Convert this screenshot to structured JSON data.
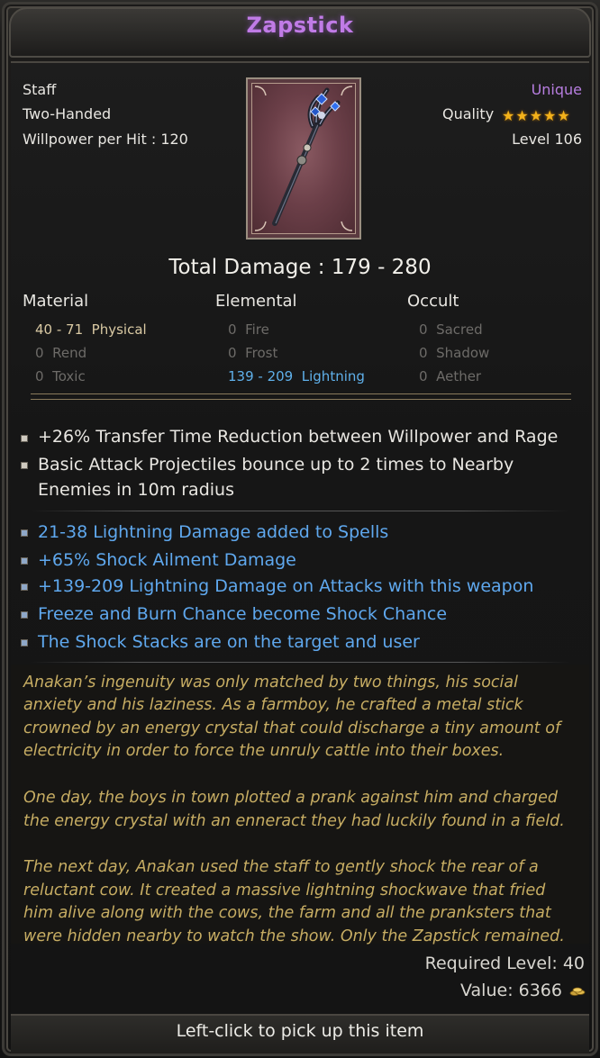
{
  "item": {
    "name": "Zapstick",
    "type": "Staff",
    "handedness": "Two-Handed",
    "willpower_label": "Willpower per Hit : 120",
    "rarity": "Unique",
    "quality_label": "Quality",
    "quality_stars": 5,
    "level_label": "Level 106",
    "icon": "staff-item-icon"
  },
  "damage": {
    "total_label": "Total Damage : 179 - 280",
    "columns": [
      "Material",
      "Elemental",
      "Occult"
    ],
    "material": [
      {
        "value": "40 - 71",
        "name": "Physical"
      },
      {
        "value": "0",
        "name": "Rend"
      },
      {
        "value": "0",
        "name": "Toxic"
      }
    ],
    "elemental": [
      {
        "value": "0",
        "name": "Fire"
      },
      {
        "value": "0",
        "name": "Frost"
      },
      {
        "value": "139 - 209",
        "name": "Lightning"
      }
    ],
    "occult": [
      {
        "value": "0",
        "name": "Sacred"
      },
      {
        "value": "0",
        "name": "Shadow"
      },
      {
        "value": "0",
        "name": "Aether"
      }
    ]
  },
  "base_mods": [
    "+26% Transfer Time Reduction between Willpower and Rage",
    "Basic Attack Projectiles bounce up to 2 times to Nearby",
    "Enemies in 10m radius"
  ],
  "unique_mods": [
    "21-38 Lightning Damage added to Spells",
    "+65% Shock Ailment Damage",
    "+139-209 Lightning Damage on Attacks with this weapon",
    "Freeze and Burn Chance become Shock Chance",
    "The Shock Stacks are on the target and user"
  ],
  "lore": [
    "Anakan’s ingenuity was only matched by two things, his social",
    "anxiety and his laziness. As a farmboy, he crafted a metal stick",
    "crowned by an energy crystal that could discharge a tiny amount of",
    "electricity in order to force the unruly cattle into their boxes.",
    "One day, the boys in town plotted a prank against him and charged",
    "the energy crystal with an enneract they had luckily found in a field.",
    "The next day, Anakan used the staff to gently shock the rear of a",
    "reluctant cow. It created a massive lightning shockwave that fried",
    "him alive along with the cows, the farm and all the pranksters that",
    "were hidden nearby to watch the show. Only the Zapstick remained."
  ],
  "requirements": {
    "required_level_label": "Required Level: 40",
    "value_label": "Value: 6366",
    "currency_icon": "gold-coins-icon"
  },
  "footer": {
    "hint": "Left-click to pick up this item"
  },
  "colors": {
    "unique": "#c07be6",
    "lightning": "#5fb0ea",
    "lore": "#c7ad63",
    "star": "#f3b21b"
  }
}
